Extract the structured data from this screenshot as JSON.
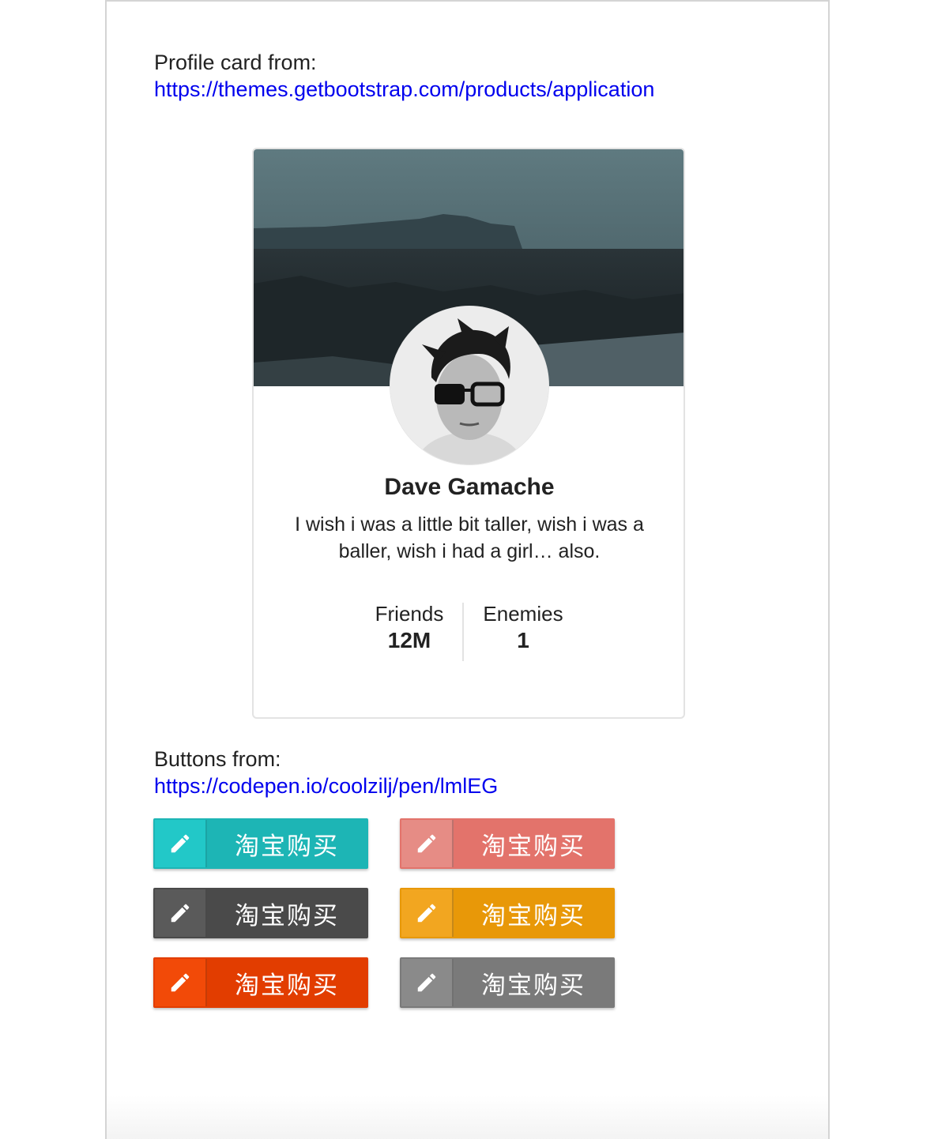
{
  "intro": {
    "label": "Profile card from:",
    "link": "https://themes.getbootstrap.com/products/application"
  },
  "profile": {
    "name": "Dave Gamache",
    "bio": "I wish i was a little bit taller, wish i was a baller, wish i had a girl… also.",
    "stats": [
      {
        "label": "Friends",
        "value": "12M"
      },
      {
        "label": "Enemies",
        "value": "1"
      }
    ]
  },
  "buttons_section": {
    "label": "Buttons from:",
    "link": "https://codepen.io/coolzilj/pen/lmlEG"
  },
  "buttons": [
    {
      "label": "淘宝购买",
      "icon": "pencil-icon",
      "color": "#1db5b5",
      "icon_color": "#22c8c8"
    },
    {
      "label": "淘宝购买",
      "icon": "pencil-icon",
      "color": "#e3736b",
      "icon_color": "#e68c85"
    },
    {
      "label": "淘宝购买",
      "icon": "pencil-icon",
      "color": "#4a4a4a",
      "icon_color": "#5a5a5a"
    },
    {
      "label": "淘宝购买",
      "icon": "pencil-icon",
      "color": "#e89808",
      "icon_color": "#f2a620"
    },
    {
      "label": "淘宝购买",
      "icon": "pencil-icon",
      "color": "#e23d00",
      "icon_color": "#f24a08"
    },
    {
      "label": "淘宝购买",
      "icon": "pencil-icon",
      "color": "#7a7a7a",
      "icon_color": "#8a8a8a"
    }
  ]
}
